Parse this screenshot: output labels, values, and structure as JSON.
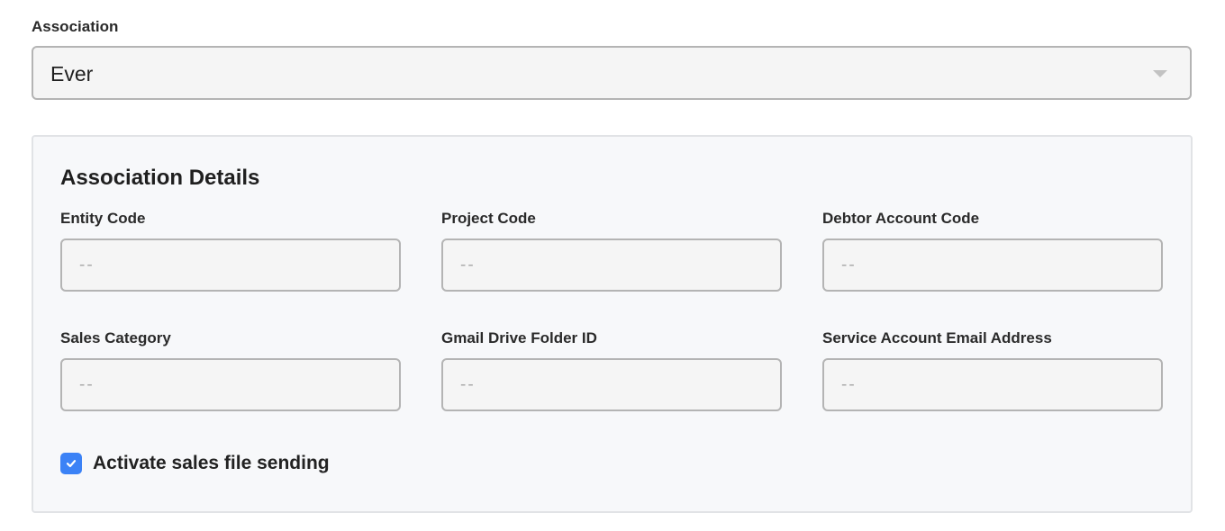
{
  "association": {
    "label": "Association",
    "selected_value": "Ever"
  },
  "details": {
    "title": "Association Details",
    "fields": [
      {
        "label": "Entity Code",
        "placeholder": "--",
        "value": ""
      },
      {
        "label": "Project Code",
        "placeholder": "--",
        "value": ""
      },
      {
        "label": "Debtor Account Code",
        "placeholder": "--",
        "value": ""
      },
      {
        "label": "Sales Category",
        "placeholder": "--",
        "value": ""
      },
      {
        "label": "Gmail Drive Folder ID",
        "placeholder": "--",
        "value": ""
      },
      {
        "label": "Service Account Email Address",
        "placeholder": "--",
        "value": ""
      }
    ],
    "checkbox": {
      "label": "Activate sales file sending",
      "checked": true
    }
  },
  "colors": {
    "accent": "#3b82f6",
    "panel_background": "#f7f8fa",
    "input_border": "#b4b4b4"
  },
  "icons": {
    "select_arrow": "chevron-down-icon",
    "checkbox_mark": "check-icon"
  }
}
